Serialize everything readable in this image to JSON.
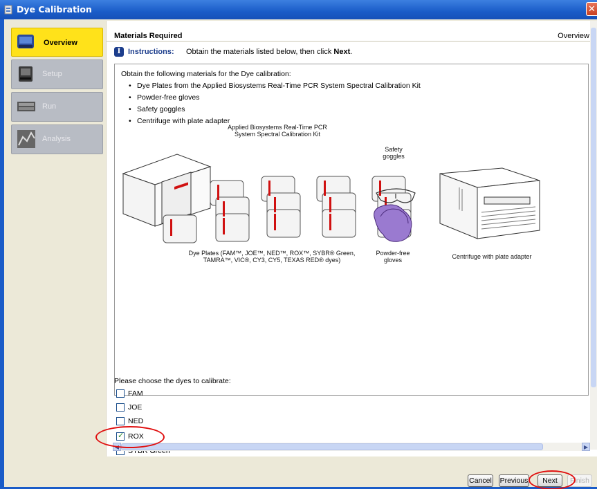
{
  "window": {
    "title": "Dye Calibration",
    "close_glyph": "✕"
  },
  "nav": {
    "items": [
      {
        "label": "Overview",
        "active": true,
        "icon": "overview-icon"
      },
      {
        "label": "Setup",
        "active": false,
        "icon": "setup-icon"
      },
      {
        "label": "Run",
        "active": false,
        "icon": "run-icon"
      },
      {
        "label": "Analysis",
        "active": false,
        "icon": "analysis-icon"
      }
    ]
  },
  "header": {
    "title": "Materials Required",
    "breadcrumb": "Overview"
  },
  "instructions": {
    "badge": "I",
    "label": "Instructions:",
    "text": "Obtain the materials listed below, then click ",
    "emphasis": "Next",
    "end": "."
  },
  "materials": {
    "intro": "Obtain the following materials for the Dye calibration:",
    "items": [
      "Dye Plates from the Applied Biosystems Real-Time PCR System Spectral Calibration Kit",
      "Powder-free gloves",
      "Safety goggles",
      "Centrifuge with plate adapter"
    ]
  },
  "illustration": {
    "kit_caption_1": "Applied Biosystems Real-Time PCR",
    "kit_caption_2": "System Spectral Calibration Kit",
    "goggles_caption_1": "Safety",
    "goggles_caption_2": "goggles",
    "plates_caption_1": "Dye Plates (FAM™, JOE™, NED™, ROX™, SYBR® Green,",
    "plates_caption_2": "TAMRA™, VIC®, CY3, CY5, TEXAS RED® dyes)",
    "gloves_caption_1": "Powder-free",
    "gloves_caption_2": "gloves",
    "centrifuge_caption": "Centrifuge with plate adapter"
  },
  "dyes": {
    "title": "Please choose the dyes to calibrate:",
    "options": [
      {
        "label": "FAM",
        "checked": false
      },
      {
        "label": "JOE",
        "checked": false
      },
      {
        "label": "NED",
        "checked": false
      },
      {
        "label": "ROX",
        "checked": true
      },
      {
        "label": "SYBR Green",
        "checked": false
      }
    ]
  },
  "buttons": {
    "cancel": "Cancel",
    "previous": "Previous",
    "next": "Next",
    "finish": "Finish"
  },
  "colors": {
    "accent": "#1a5cc8",
    "active_nav": "#ffe21a",
    "highlight": "#e01010"
  }
}
